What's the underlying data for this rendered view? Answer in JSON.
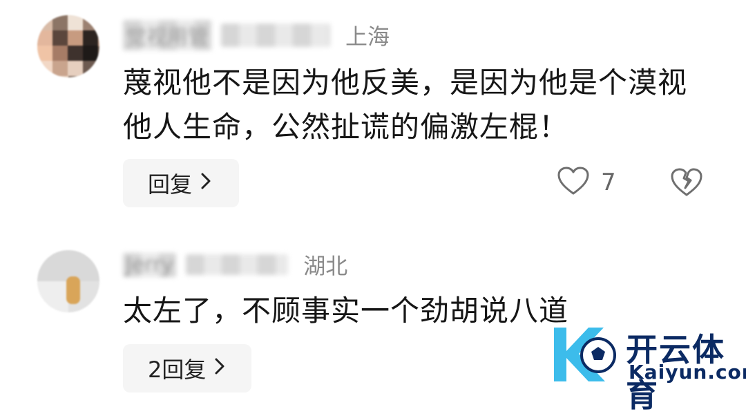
{
  "comments": [
    {
      "author": "觉视用管",
      "location": "上海",
      "text": "蔑视他不是因为他反美，是因为他是个漠视他人生命，公然扯谎的偏激左棍！",
      "reply_label": "回复",
      "like_count": "7",
      "avatar_icon": "pixelated-avatar"
    },
    {
      "author": "Jerry",
      "location": "湖北",
      "text": "太左了，不顾事实一个劲胡说八道",
      "reply_label": "2回复",
      "avatar_icon": "pixelated-avatar"
    }
  ],
  "icons": {
    "chevron": "chevron-right-icon",
    "like": "heart-outline-icon",
    "dislike": "broken-heart-icon"
  },
  "watermark": {
    "brand": "开云体育",
    "domain": "Kaiyun.com"
  },
  "colors": {
    "text": "#161616",
    "muted": "#8a8a8a",
    "button_bg": "#f5f5f5",
    "watermark": "#0b2a63",
    "watermark_accent": "#1ab0e8"
  }
}
